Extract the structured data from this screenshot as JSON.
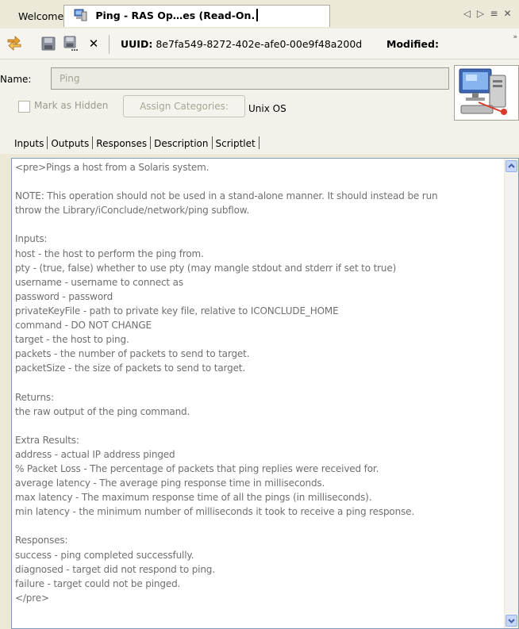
{
  "tabs": [
    {
      "label": "Welcome"
    },
    {
      "label": "Ping - RAS Op…es (Read-On."
    }
  ],
  "tab_controls": {
    "left": "◁",
    "right": "▷",
    "list": "≡",
    "close": "✕"
  },
  "toolbar": {
    "uuid_label": "UUID:",
    "uuid_value": "8e7fa549-8272-402e-afe0-00e9f48a200d",
    "modified_label": "Modified:"
  },
  "properties": {
    "name_label": "Name:",
    "name_value": "Ping",
    "mark_hidden_label": "Mark as Hidden",
    "mark_hidden_checked": false,
    "assign_categories_label": "Assign Categories:",
    "category": "Unix OS"
  },
  "section_tabs": [
    "Inputs",
    "Outputs",
    "Responses",
    "Description",
    "Scriptlet"
  ],
  "active_section": "Description",
  "description_lines": [
    "<pre>Pings a host from a Solaris system.",
    "",
    "NOTE: This operation should not be used in a stand-alone manner. It should instead be run",
    "throw the Library/iConclude/network/ping subflow.",
    "",
    "Inputs:",
    "host - the host to perform the ping from.",
    "pty - (true, false) whether to use pty (may mangle stdout and stderr if set to true)",
    "username - username to connect as",
    "password - password",
    "privateKeyFile - path to private key file, relative to ICONCLUDE_HOME",
    "command - DO NOT CHANGE",
    "target - the host to ping.",
    "packets - the number of packets to send to target.",
    "packetSize - the size of packets to send to target.",
    "",
    "Returns:",
    "the raw output of the ping command.",
    "",
    "Extra Results:",
    "address - actual IP address pinged",
    "% Packet Loss - The percentage of packets that ping replies were received for.",
    "average latency - The average ping response time in milliseconds.",
    "max latency - The maximum response time of all the pings (in milliseconds).",
    "min latency - the minimum number of milliseconds it took to receive a ping response.",
    "",
    "Responses:",
    "success - ping completed successfully.",
    "diagnosed - target did not respond to ping.",
    "failure - target could not be pinged.",
    "</pre>"
  ]
}
